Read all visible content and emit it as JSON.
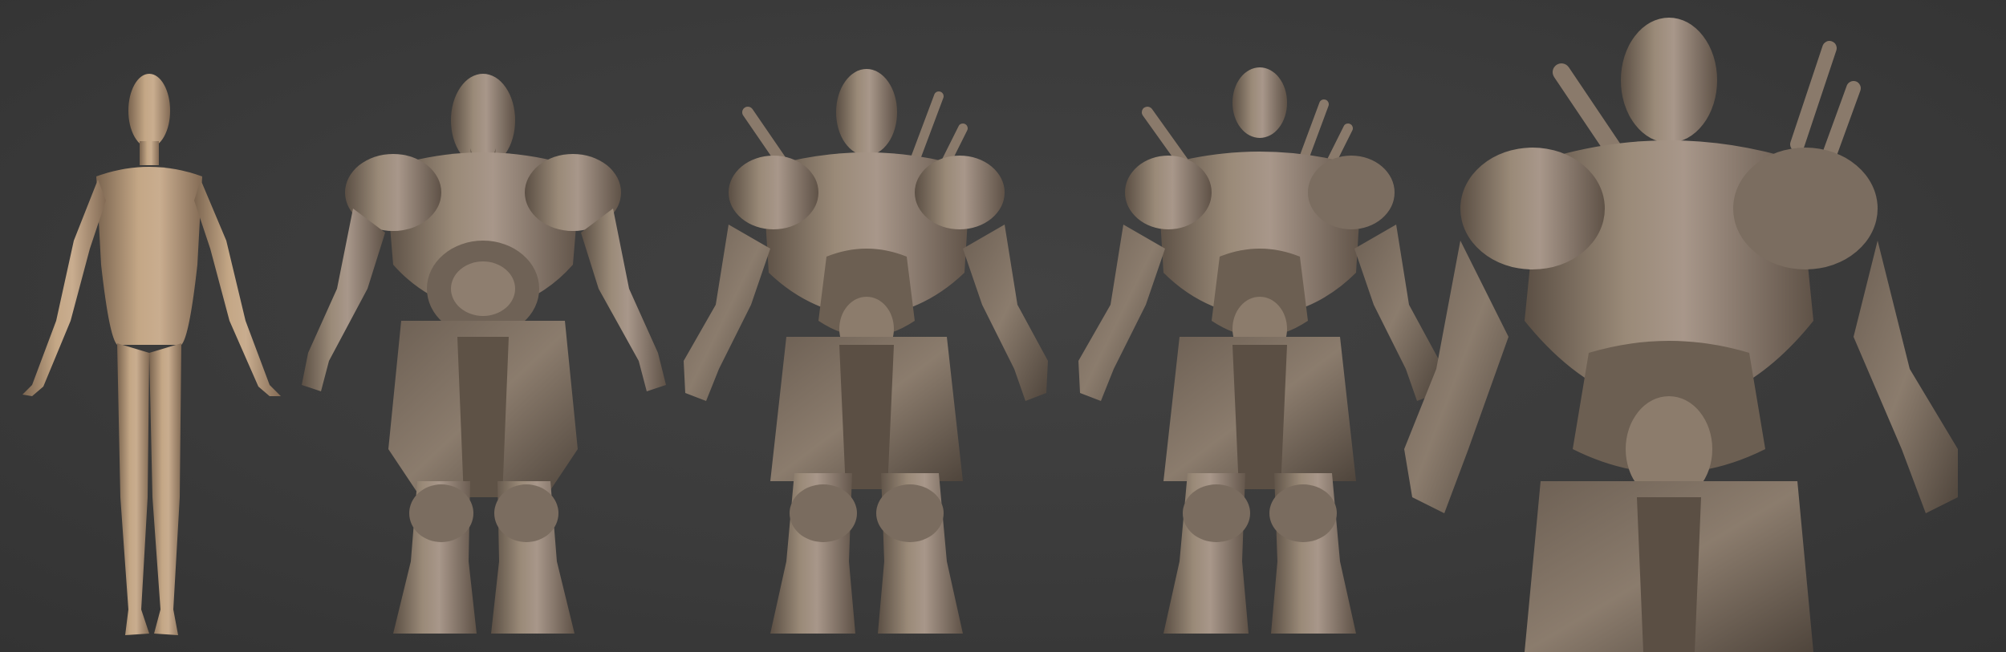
{
  "scene": {
    "background": "#3a3a3a",
    "material_base": "#8a7b6c",
    "material_base_stage": "#a08a70",
    "highlight": "#c2ad95",
    "shadow": "#4e4339"
  },
  "figures": [
    {
      "stage": 1,
      "description_icon": "base-mesh-mannequin"
    },
    {
      "stage": 2,
      "description_icon": "blockout-orc"
    },
    {
      "stage": 3,
      "description_icon": "detailed-orc"
    },
    {
      "stage": 4,
      "description_icon": "refined-warrior"
    },
    {
      "stage": 5,
      "description_icon": "final-closeup-warrior"
    }
  ]
}
